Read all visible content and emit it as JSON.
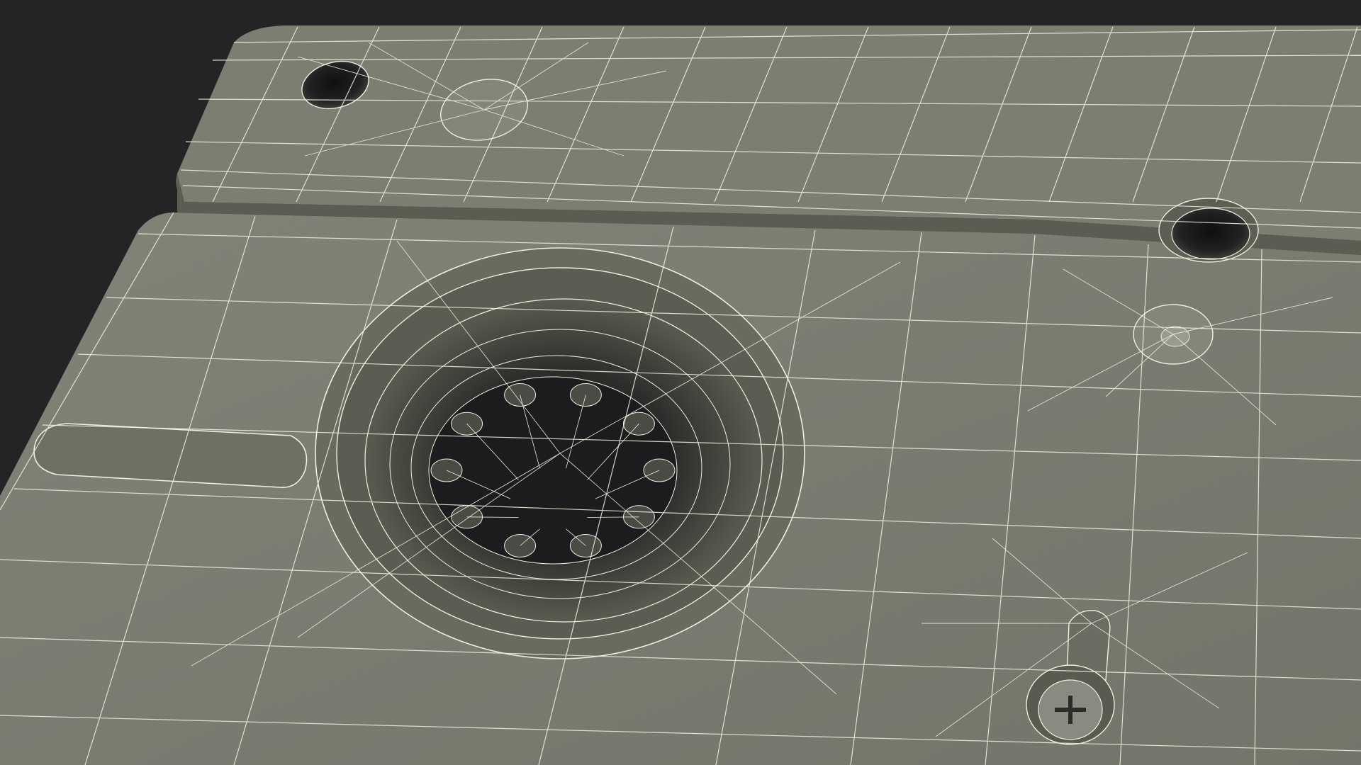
{
  "scene": {
    "subject": "",
    "colors": {
      "background": "#232425",
      "surface": "#7a7b6f",
      "surface_light": "#85867a",
      "surface_dark": "#626357",
      "recess": "#3e3f38",
      "hole": "#15171a",
      "wire": "#f2f2e2"
    }
  }
}
